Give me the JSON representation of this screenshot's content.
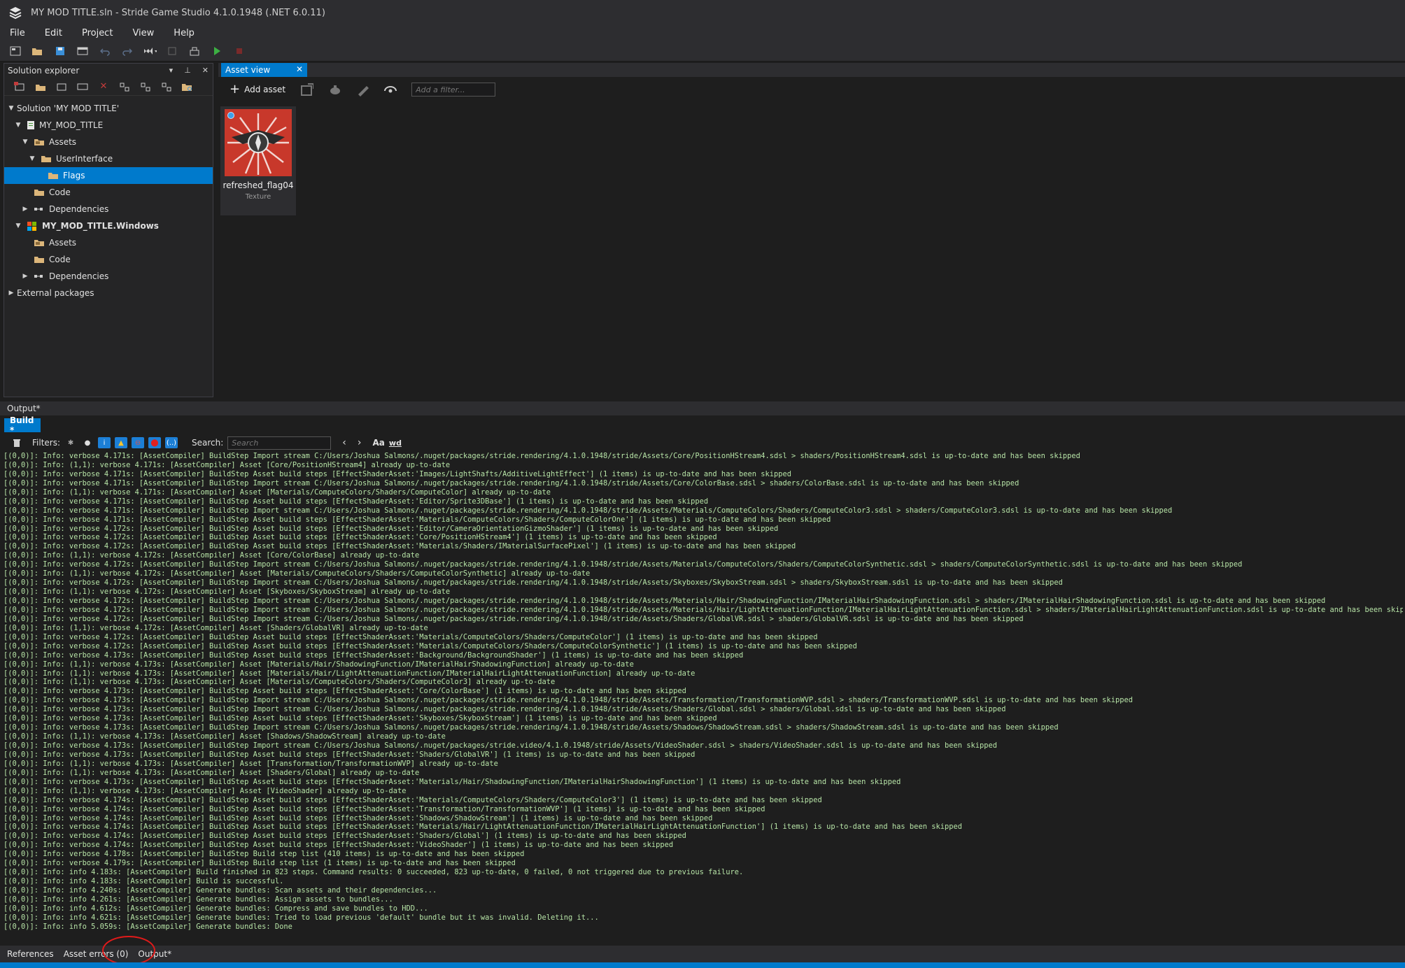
{
  "window": {
    "title": "MY MOD TITLE.sln - Stride Game Studio 4.1.0.1948 (.NET 6.0.11)"
  },
  "menu": [
    "File",
    "Edit",
    "Project",
    "View",
    "Help"
  ],
  "solution_explorer": {
    "title": "Solution explorer",
    "tree": [
      {
        "label": "Solution 'MY MOD TITLE'",
        "depth": 0,
        "arrow": "▼",
        "icon": "none",
        "selected": false,
        "bold": false
      },
      {
        "label": "MY_MOD_TITLE",
        "depth": 1,
        "arrow": "▼",
        "icon": "project",
        "selected": false,
        "bold": false
      },
      {
        "label": "Assets",
        "depth": 2,
        "arrow": "▼",
        "icon": "assets-folder",
        "selected": false,
        "bold": false
      },
      {
        "label": "UserInterface",
        "depth": 3,
        "arrow": "▼",
        "icon": "folder",
        "selected": false,
        "bold": false
      },
      {
        "label": "Flags",
        "depth": 4,
        "arrow": "",
        "icon": "folder",
        "selected": true,
        "bold": false
      },
      {
        "label": "Code",
        "depth": 2,
        "arrow": "",
        "icon": "code-folder",
        "selected": false,
        "bold": false
      },
      {
        "label": "Dependencies",
        "depth": 2,
        "arrow": "▶",
        "icon": "dependencies",
        "selected": false,
        "bold": false
      },
      {
        "label": "MY_MOD_TITLE.Windows",
        "depth": 1,
        "arrow": "▼",
        "icon": "windows",
        "selected": false,
        "bold": true
      },
      {
        "label": "Assets",
        "depth": 2,
        "arrow": "",
        "icon": "assets-folder",
        "selected": false,
        "bold": false
      },
      {
        "label": "Code",
        "depth": 2,
        "arrow": "",
        "icon": "code-folder",
        "selected": false,
        "bold": false
      },
      {
        "label": "Dependencies",
        "depth": 2,
        "arrow": "▶",
        "icon": "dependencies",
        "selected": false,
        "bold": false
      },
      {
        "label": "External packages",
        "depth": 0,
        "arrow": "▶",
        "icon": "none",
        "selected": false,
        "bold": false
      }
    ]
  },
  "asset_view": {
    "tab_label": "Asset view",
    "add_asset_label": "Add asset",
    "filter_placeholder": "Add a filter...",
    "assets": [
      {
        "name": "refreshed_flag04",
        "type": "Texture"
      }
    ]
  },
  "output": {
    "header": "Output*",
    "build_tab": "Build *",
    "filters_label": "Filters:",
    "search_label": "Search:",
    "search_placeholder": "Search",
    "case_toggle": "Aa",
    "word_toggle": "wd",
    "log": [
      "[(0,0)]: Info: verbose 4.171s: [AssetCompiler] BuildStep Import stream C:/Users/Joshua Salmons/.nuget/packages/stride.rendering/4.1.0.1948/stride/Assets/Core/PositionHStream4.sdsl > shaders/PositionHStream4.sdsl is up-to-date and has been skipped",
      "[(0,0)]: Info: (1,1): verbose 4.171s: [AssetCompiler] Asset [Core/PositionHStream4] already up-to-date",
      "[(0,0)]: Info: verbose 4.171s: [AssetCompiler] BuildStep Asset build steps [EffectShaderAsset:'Images/LightShafts/AdditiveLightEffect'] (1 items) is up-to-date and has been skipped",
      "[(0,0)]: Info: verbose 4.171s: [AssetCompiler] BuildStep Import stream C:/Users/Joshua Salmons/.nuget/packages/stride.rendering/4.1.0.1948/stride/Assets/Core/ColorBase.sdsl > shaders/ColorBase.sdsl is up-to-date and has been skipped",
      "[(0,0)]: Info: (1,1): verbose 4.171s: [AssetCompiler] Asset [Materials/ComputeColors/Shaders/ComputeColor] already up-to-date",
      "[(0,0)]: Info: verbose 4.171s: [AssetCompiler] BuildStep Asset build steps [EffectShaderAsset:'Editor/Sprite3DBase'] (1 items) is up-to-date and has been skipped",
      "[(0,0)]: Info: verbose 4.171s: [AssetCompiler] BuildStep Import stream C:/Users/Joshua Salmons/.nuget/packages/stride.rendering/4.1.0.1948/stride/Assets/Materials/ComputeColors/Shaders/ComputeColor3.sdsl > shaders/ComputeColor3.sdsl is up-to-date and has been skipped",
      "[(0,0)]: Info: verbose 4.171s: [AssetCompiler] BuildStep Asset build steps [EffectShaderAsset:'Materials/ComputeColors/Shaders/ComputeColorOne'] (1 items) is up-to-date and has been skipped",
      "[(0,0)]: Info: verbose 4.172s: [AssetCompiler] BuildStep Asset build steps [EffectShaderAsset:'Editor/CameraOrientationGizmoShader'] (1 items) is up-to-date and has been skipped",
      "[(0,0)]: Info: verbose 4.172s: [AssetCompiler] BuildStep Asset build steps [EffectShaderAsset:'Core/PositionHStream4'] (1 items) is up-to-date and has been skipped",
      "[(0,0)]: Info: verbose 4.172s: [AssetCompiler] BuildStep Asset build steps [EffectShaderAsset:'Materials/Shaders/IMaterialSurfacePixel'] (1 items) is up-to-date and has been skipped",
      "[(0,0)]: Info: (1,1): verbose 4.172s: [AssetCompiler] Asset [Core/ColorBase] already up-to-date",
      "[(0,0)]: Info: verbose 4.172s: [AssetCompiler] BuildStep Import stream C:/Users/Joshua Salmons/.nuget/packages/stride.rendering/4.1.0.1948/stride/Assets/Materials/ComputeColors/Shaders/ComputeColorSynthetic.sdsl > shaders/ComputeColorSynthetic.sdsl is up-to-date and has been skipped",
      "[(0,0)]: Info: (1,1): verbose 4.172s: [AssetCompiler] Asset [Materials/ComputeColors/Shaders/ComputeColorSynthetic] already up-to-date",
      "[(0,0)]: Info: verbose 4.172s: [AssetCompiler] BuildStep Import stream C:/Users/Joshua Salmons/.nuget/packages/stride.rendering/4.1.0.1948/stride/Assets/Skyboxes/SkyboxStream.sdsl > shaders/SkyboxStream.sdsl is up-to-date and has been skipped",
      "[(0,0)]: Info: (1,1): verbose 4.172s: [AssetCompiler] Asset [Skyboxes/SkyboxStream] already up-to-date",
      "[(0,0)]: Info: verbose 4.172s: [AssetCompiler] BuildStep Import stream C:/Users/Joshua Salmons/.nuget/packages/stride.rendering/4.1.0.1948/stride/Assets/Materials/Hair/ShadowingFunction/IMaterialHairShadowingFunction.sdsl > shaders/IMaterialHairShadowingFunction.sdsl is up-to-date and has been skipped",
      "[(0,0)]: Info: verbose 4.172s: [AssetCompiler] BuildStep Import stream C:/Users/Joshua Salmons/.nuget/packages/stride.rendering/4.1.0.1948/stride/Assets/Materials/Hair/LightAttenuationFunction/IMaterialHairLightAttenuationFunction.sdsl > shaders/IMaterialHairLightAttenuationFunction.sdsl is up-to-date and has been skipped",
      "[(0,0)]: Info: verbose 4.172s: [AssetCompiler] BuildStep Import stream C:/Users/Joshua Salmons/.nuget/packages/stride.rendering/4.1.0.1948/stride/Assets/Shaders/GlobalVR.sdsl > shaders/GlobalVR.sdsl is up-to-date and has been skipped",
      "[(0,0)]: Info: (1,1): verbose 4.172s: [AssetCompiler] Asset [Shaders/GlobalVR] already up-to-date",
      "[(0,0)]: Info: verbose 4.172s: [AssetCompiler] BuildStep Asset build steps [EffectShaderAsset:'Materials/ComputeColors/Shaders/ComputeColor'] (1 items) is up-to-date and has been skipped",
      "[(0,0)]: Info: verbose 4.172s: [AssetCompiler] BuildStep Asset build steps [EffectShaderAsset:'Materials/ComputeColors/Shaders/ComputeColorSynthetic'] (1 items) is up-to-date and has been skipped",
      "[(0,0)]: Info: verbose 4.173s: [AssetCompiler] BuildStep Asset build steps [EffectShaderAsset:'Background/BackgroundShader'] (1 items) is up-to-date and has been skipped",
      "[(0,0)]: Info: (1,1): verbose 4.173s: [AssetCompiler] Asset [Materials/Hair/ShadowingFunction/IMaterialHairShadowingFunction] already up-to-date",
      "[(0,0)]: Info: (1,1): verbose 4.173s: [AssetCompiler] Asset [Materials/Hair/LightAttenuationFunction/IMaterialHairLightAttenuationFunction] already up-to-date",
      "[(0,0)]: Info: (1,1): verbose 4.173s: [AssetCompiler] Asset [Materials/ComputeColors/Shaders/ComputeColor3] already up-to-date",
      "[(0,0)]: Info: verbose 4.173s: [AssetCompiler] BuildStep Asset build steps [EffectShaderAsset:'Core/ColorBase'] (1 items) is up-to-date and has been skipped",
      "[(0,0)]: Info: verbose 4.173s: [AssetCompiler] BuildStep Import stream C:/Users/Joshua Salmons/.nuget/packages/stride.rendering/4.1.0.1948/stride/Assets/Transformation/TransformationWVP.sdsl > shaders/TransformationWVP.sdsl is up-to-date and has been skipped",
      "[(0,0)]: Info: verbose 4.173s: [AssetCompiler] BuildStep Import stream C:/Users/Joshua Salmons/.nuget/packages/stride.rendering/4.1.0.1948/stride/Assets/Shaders/Global.sdsl > shaders/Global.sdsl is up-to-date and has been skipped",
      "[(0,0)]: Info: verbose 4.173s: [AssetCompiler] BuildStep Asset build steps [EffectShaderAsset:'Skyboxes/SkyboxStream'] (1 items) is up-to-date and has been skipped",
      "[(0,0)]: Info: verbose 4.173s: [AssetCompiler] BuildStep Import stream C:/Users/Joshua Salmons/.nuget/packages/stride.rendering/4.1.0.1948/stride/Assets/Shadows/ShadowStream.sdsl > shaders/ShadowStream.sdsl is up-to-date and has been skipped",
      "[(0,0)]: Info: (1,1): verbose 4.173s: [AssetCompiler] Asset [Shadows/ShadowStream] already up-to-date",
      "[(0,0)]: Info: verbose 4.173s: [AssetCompiler] BuildStep Import stream C:/Users/Joshua Salmons/.nuget/packages/stride.video/4.1.0.1948/stride/Assets/VideoShader.sdsl > shaders/VideoShader.sdsl is up-to-date and has been skipped",
      "[(0,0)]: Info: verbose 4.173s: [AssetCompiler] BuildStep Asset build steps [EffectShaderAsset:'Shaders/GlobalVR'] (1 items) is up-to-date and has been skipped",
      "[(0,0)]: Info: (1,1): verbose 4.173s: [AssetCompiler] Asset [Transformation/TransformationWVP] already up-to-date",
      "[(0,0)]: Info: (1,1): verbose 4.173s: [AssetCompiler] Asset [Shaders/Global] already up-to-date",
      "[(0,0)]: Info: verbose 4.173s: [AssetCompiler] BuildStep Asset build steps [EffectShaderAsset:'Materials/Hair/ShadowingFunction/IMaterialHairShadowingFunction'] (1 items) is up-to-date and has been skipped",
      "[(0,0)]: Info: (1,1): verbose 4.173s: [AssetCompiler] Asset [VideoShader] already up-to-date",
      "[(0,0)]: Info: verbose 4.174s: [AssetCompiler] BuildStep Asset build steps [EffectShaderAsset:'Materials/ComputeColors/Shaders/ComputeColor3'] (1 items) is up-to-date and has been skipped",
      "[(0,0)]: Info: verbose 4.174s: [AssetCompiler] BuildStep Asset build steps [EffectShaderAsset:'Transformation/TransformationWVP'] (1 items) is up-to-date and has been skipped",
      "[(0,0)]: Info: verbose 4.174s: [AssetCompiler] BuildStep Asset build steps [EffectShaderAsset:'Shadows/ShadowStream'] (1 items) is up-to-date and has been skipped",
      "[(0,0)]: Info: verbose 4.174s: [AssetCompiler] BuildStep Asset build steps [EffectShaderAsset:'Materials/Hair/LightAttenuationFunction/IMaterialHairLightAttenuationFunction'] (1 items) is up-to-date and has been skipped",
      "[(0,0)]: Info: verbose 4.174s: [AssetCompiler] BuildStep Asset build steps [EffectShaderAsset:'Shaders/Global'] (1 items) is up-to-date and has been skipped",
      "[(0,0)]: Info: verbose 4.174s: [AssetCompiler] BuildStep Asset build steps [EffectShaderAsset:'VideoShader'] (1 items) is up-to-date and has been skipped",
      "[(0,0)]: Info: verbose 4.178s: [AssetCompiler] BuildStep Build step list (410 items) is up-to-date and has been skipped",
      "[(0,0)]: Info: verbose 4.179s: [AssetCompiler] BuildStep Build step list (1 items) is up-to-date and has been skipped",
      "[(0,0)]: Info: info 4.183s: [AssetCompiler] Build finished in 823 steps. Command results: 0 succeeded, 823 up-to-date, 0 failed, 0 not triggered due to previous failure.",
      "[(0,0)]: Info: info 4.183s: [AssetCompiler] Build is successful.",
      "[(0,0)]: Info: info 4.240s: [AssetCompiler] Generate bundles: Scan assets and their dependencies...",
      "[(0,0)]: Info: info 4.261s: [AssetCompiler] Generate bundles: Assign assets to bundles...",
      "[(0,0)]: Info: info 4.612s: [AssetCompiler] Generate bundles: Compress and save bundles to HDD...",
      "[(0,0)]: Info: info 4.621s: [AssetCompiler] Generate bundles: Tried to load previous 'default' bundle but it was invalid. Deleting it...",
      "[(0,0)]: Info: info 5.059s: [AssetCompiler] Generate bundles: Done"
    ]
  },
  "bottom_tabs": [
    "References",
    "Asset errors (0)",
    "Output*"
  ],
  "colors": {
    "accent": "#007acc",
    "log_text": "#b6e3a6",
    "annotation_circle": "#e01a1a"
  }
}
